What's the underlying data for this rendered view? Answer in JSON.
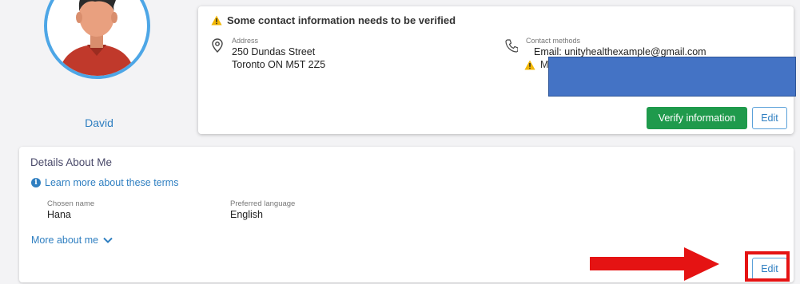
{
  "profile": {
    "name": "David",
    "avatar_icon": "person-avatar-icon"
  },
  "contact_card": {
    "warning_text": "Some contact information needs to be verified",
    "address": {
      "label": "Address",
      "line1": "250 Dundas Street",
      "line2": "Toronto ON M5T 2Z5"
    },
    "contact_methods": {
      "label": "Contact methods",
      "email": "Email: unityhealthexample@gmail.com",
      "second_line_partial": "M"
    },
    "verify_button": "Verify information",
    "edit_button": "Edit"
  },
  "details_card": {
    "title": "Details About Me",
    "learn_link": "Learn more about these terms",
    "chosen_name": {
      "label": "Chosen name",
      "value": "Hana"
    },
    "preferred_language": {
      "label": "Preferred language",
      "value": "English"
    },
    "more_link": "More about me",
    "edit_button": "Edit"
  },
  "colors": {
    "accent_blue": "#2f7fc1",
    "verify_green": "#1f9a4c",
    "warning_yellow": "#f2b705",
    "annotation_red": "#e51313",
    "redaction_blue": "#4473c5"
  }
}
